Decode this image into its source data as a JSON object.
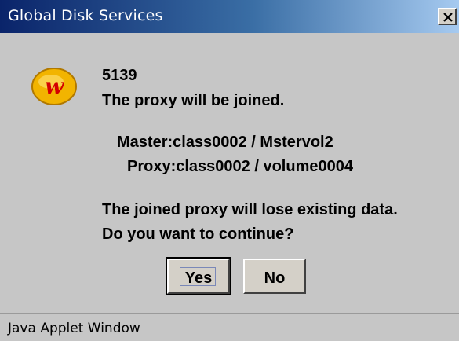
{
  "window": {
    "title": "Global Disk Services"
  },
  "message": {
    "code": "5139",
    "main": "The proxy will be joined.",
    "master": "Master:class0002 / Mstervol2",
    "proxy": "Proxy:class0002 / volume0004",
    "warning": "The joined proxy will lose existing data.",
    "question": "Do you want to continue?"
  },
  "buttons": {
    "yes": "Yes",
    "no": "No"
  },
  "status": {
    "text": "Java Applet Window"
  },
  "icons": {
    "app": "web-w-logo-icon",
    "close": "close-icon"
  },
  "colors": {
    "titlebar_start": "#0a246a",
    "titlebar_end": "#a6caf0",
    "logo_fill": "#f2b400",
    "logo_letter": "#d40000"
  }
}
